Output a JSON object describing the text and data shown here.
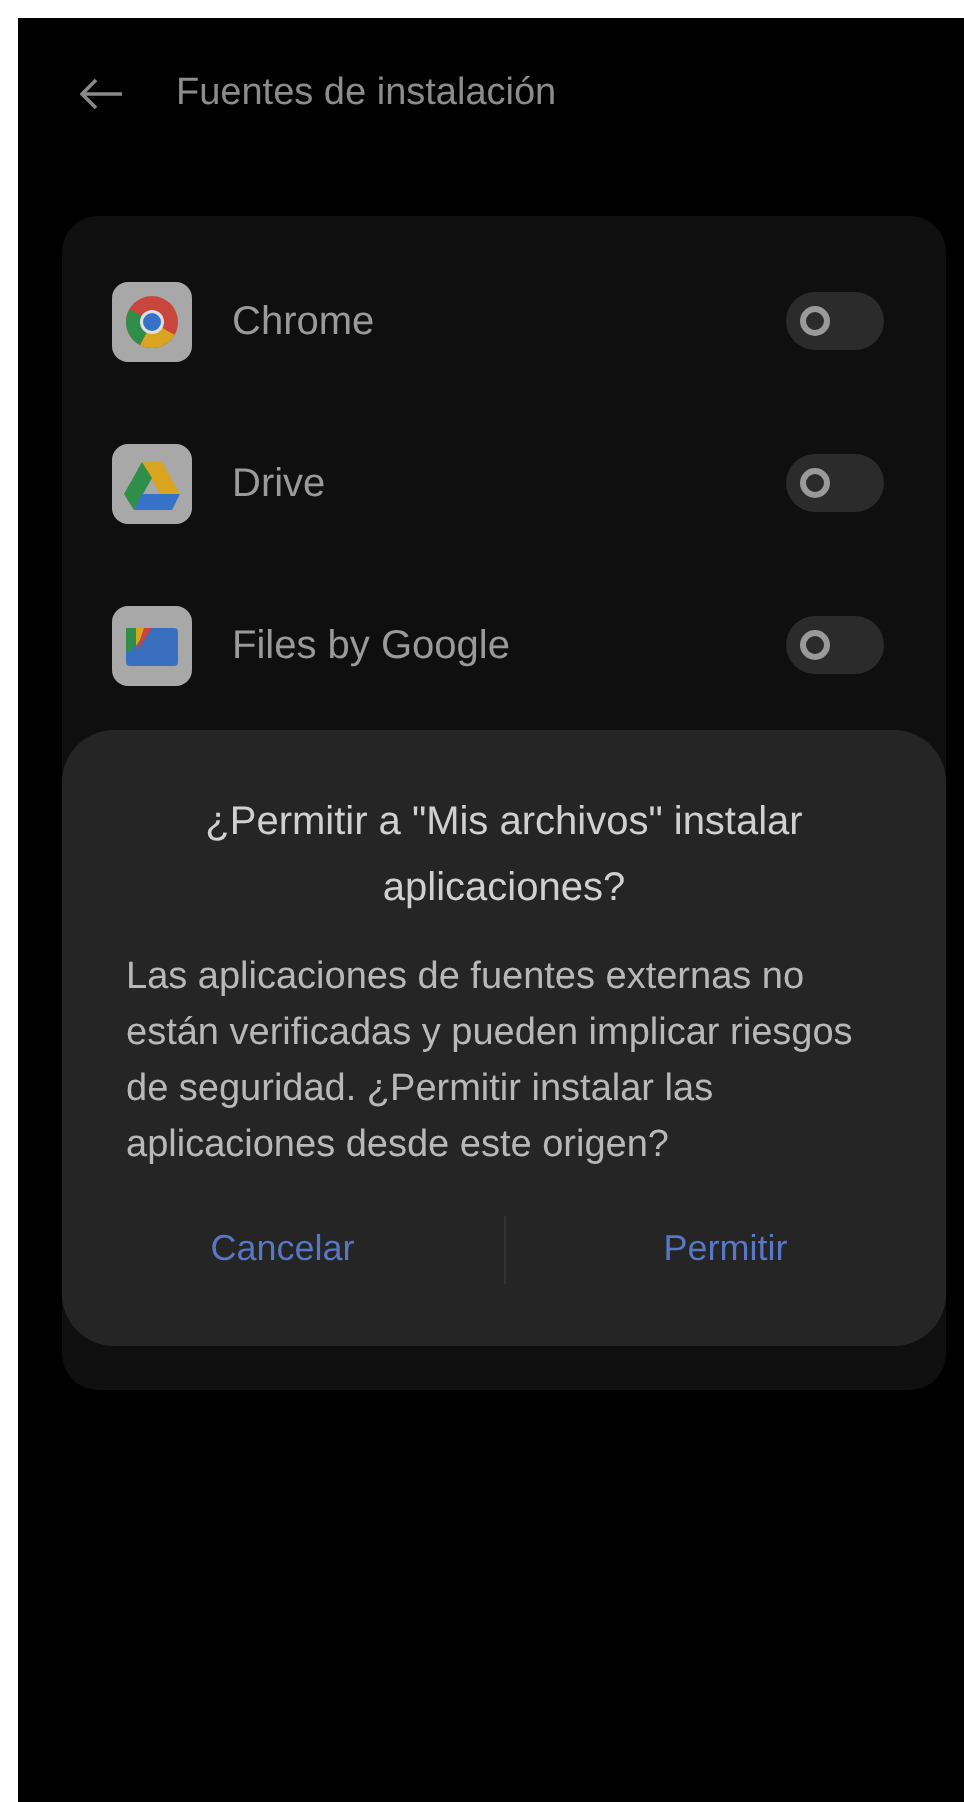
{
  "header": {
    "title": "Fuentes de instalación"
  },
  "apps": [
    {
      "name": "Chrome",
      "kind": "chrome",
      "on": false
    },
    {
      "name": "Drive",
      "kind": "drive",
      "on": false
    },
    {
      "name": "Files by Google",
      "kind": "files",
      "on": false
    }
  ],
  "dialog": {
    "title": "¿Permitir a \"Mis archivos\" instalar aplicaciones?",
    "message": "Las aplicaciones de fuentes externas no están verificadas y pueden implicar riesgos de seguridad. ¿Permitir instalar las aplicaciones desde este origen?",
    "buttons": [
      "Cancelar",
      "Permitir"
    ]
  }
}
